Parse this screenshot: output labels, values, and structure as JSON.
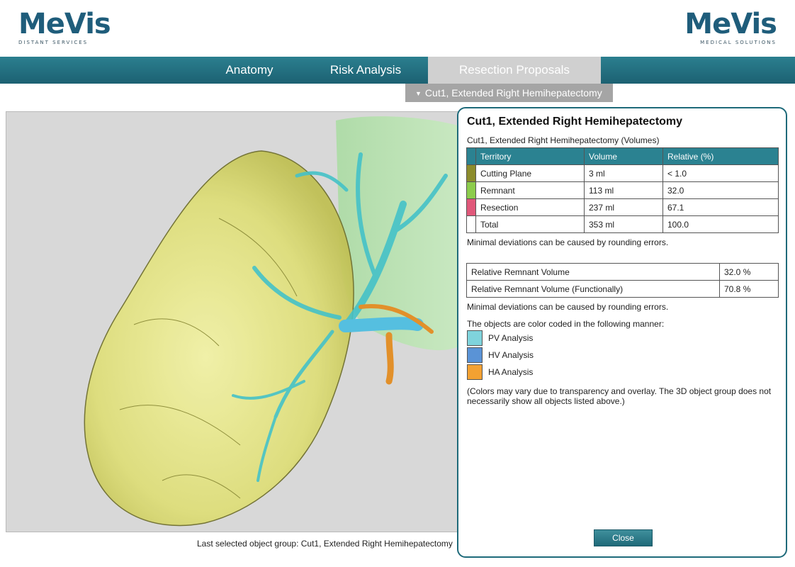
{
  "branding": {
    "left_logo": "MeVis",
    "left_sub": "DISTANT SERVICES",
    "right_logo": "MeVis",
    "right_sub": "MEDICAL SOLUTIONS"
  },
  "nav": {
    "tabs": [
      {
        "label": "Anatomy"
      },
      {
        "label": "Risk Analysis"
      },
      {
        "label": "Resection Proposals",
        "active": true
      }
    ],
    "subtab": "Cut1, Extended Right Hemihepatectomy"
  },
  "viewer": {
    "status": "Last selected object group:  Cut1, Extended Right Hemihepatectomy"
  },
  "panel": {
    "title": "Cut1, Extended Right Hemihepatectomy",
    "subtitle": "Cut1, Extended Right Hemihepatectomy (Volumes)",
    "columns": [
      "Territory",
      "Volume",
      "Relative (%)"
    ],
    "rows": [
      {
        "territory": "Cutting Plane",
        "volume": "3 ml",
        "relative": "< 1.0",
        "color": "#8c8c2c"
      },
      {
        "territory": "Remnant",
        "volume": "113 ml",
        "relative": "32.0",
        "color": "#8ccc4c"
      },
      {
        "territory": "Resection",
        "volume": "237 ml",
        "relative": "67.1",
        "color": "#e0587a"
      },
      {
        "territory": "Total",
        "volume": "353 ml",
        "relative": "100.0",
        "color": "#ffffff"
      }
    ],
    "note1": "Minimal deviations can be caused by rounding errors.",
    "rrv": [
      {
        "label": "Relative Remnant Volume",
        "value": "32.0 %"
      },
      {
        "label": "Relative Remnant Volume (Functionally)",
        "value": "70.8 %"
      }
    ],
    "note2": "Minimal deviations can be caused by rounding errors.",
    "legend_title": "The objects are color coded in the following manner:",
    "legend": [
      {
        "label": "PV Analysis",
        "color": "#7fd3dc"
      },
      {
        "label": "HV Analysis",
        "color": "#5a93d6"
      },
      {
        "label": "HA Analysis",
        "color": "#f3a132"
      }
    ],
    "legend_note": "(Colors may vary due to transparency and overlay. The 3D object group does not necessarily show all objects listed above.)",
    "close_label": "Close"
  }
}
